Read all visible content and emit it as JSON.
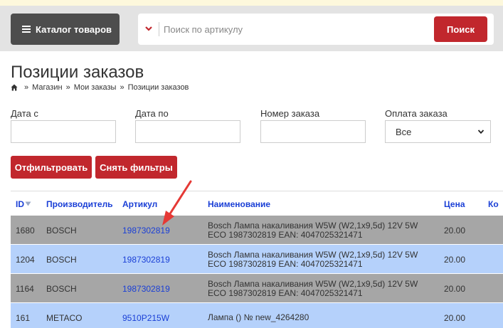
{
  "header": {
    "catalog_label": "Каталог товаров",
    "search_placeholder": "Поиск по артикулу",
    "search_button": "Поиск"
  },
  "page": {
    "title": "Позиции заказов",
    "breadcrumb": [
      "Магазин",
      "Мои заказы",
      "Позиции заказов"
    ]
  },
  "filters": {
    "date_from_label": "Дата с",
    "date_to_label": "Дата по",
    "order_number_label": "Номер заказа",
    "payment_label": "Оплата заказа",
    "payment_value": "Все",
    "apply_button": "Отфильтровать",
    "reset_button": "Снять фильтры"
  },
  "table": {
    "columns": [
      "ID",
      "Производитель",
      "Артикул",
      "Наименование",
      "Цена",
      "Ко"
    ],
    "rows": [
      {
        "id": "1680",
        "manufacturer": "BOSCH",
        "article": "1987302819",
        "name_line1": "Bosch Лампа накаливания W5W (W2,1x9,5d) 12V 5W",
        "name_line2": "ECO 1987302819 EAN: 4047025321471",
        "price": "20.00",
        "color": "#a6a6a6"
      },
      {
        "id": "1204",
        "manufacturer": "BOSCH",
        "article": "1987302819",
        "name_line1": "Bosch Лампа накаливания W5W (W2,1x9,5d) 12V 5W",
        "name_line2": "ECO 1987302819 EAN: 4047025321471",
        "price": "20.00",
        "color": "#b5d1fb"
      },
      {
        "id": "1164",
        "manufacturer": "BOSCH",
        "article": "1987302819",
        "name_line1": "Bosch Лампа накаливания W5W (W2,1x9,5d) 12V 5W",
        "name_line2": "ECO 1987302819 EAN: 4047025321471",
        "price": "20.00",
        "color": "#a6a6a6"
      },
      {
        "id": "161",
        "manufacturer": "METACO",
        "article": "9510P215W",
        "name_line1": "Лампа () № new_4264280",
        "name_line2": "",
        "price": "20.00",
        "color": "#b5d1fb"
      }
    ]
  },
  "colors": {
    "accent": "#c1272d",
    "link": "#1a3fd6",
    "row_gray": "#a6a6a6",
    "row_blue": "#b5d1fb",
    "annotation_arrow": "#e53935"
  }
}
